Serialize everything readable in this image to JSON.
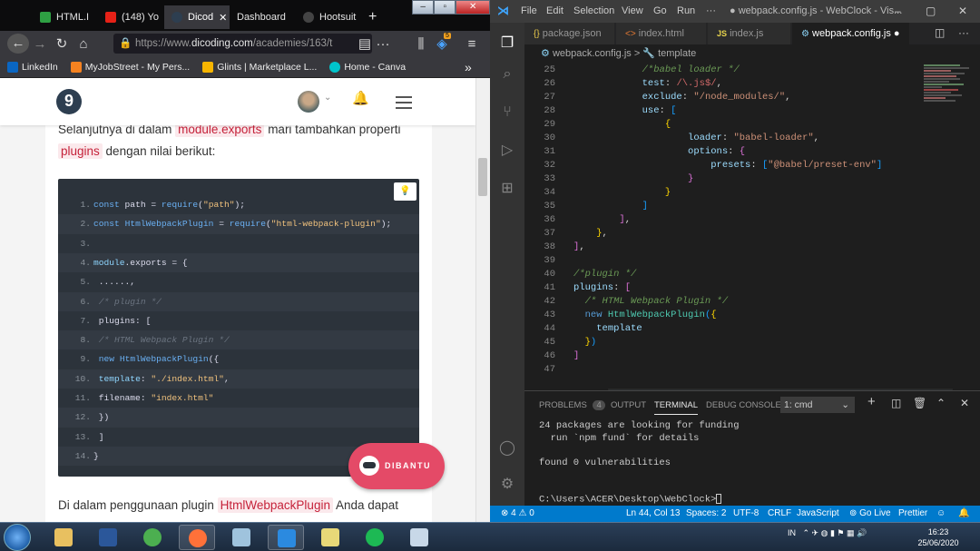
{
  "browser": {
    "tabs": [
      {
        "label": "HTML.I",
        "color": "#2ea043"
      },
      {
        "label": "(148) Yo",
        "color": "#e62117"
      },
      {
        "label": "Dicod",
        "color": "#2d3e50"
      },
      {
        "label": "Dashboard",
        "color": "#666"
      },
      {
        "label": "Hootsuit",
        "color": "#222"
      }
    ],
    "new_tab": "+",
    "url_prefix": "https://www.",
    "url_domain": "dicoding.com",
    "url_rest": "/academies/163/t",
    "ext_badge": "5",
    "bookmarks": [
      {
        "label": "LinkedIn",
        "color": "#0a66c2"
      },
      {
        "label": "MyJobStreet - My Pers...",
        "color": "#f58220"
      },
      {
        "label": "Glints | Marketplace L...",
        "color": "#f7b500"
      },
      {
        "label": "Home - Canva",
        "color": "#00c4cc"
      }
    ],
    "more": "»"
  },
  "site": {
    "logo": "9",
    "para1_a": "Selanjutnya di dalam",
    "para1_code": "module.exports",
    "para1_b": "mari tambahkan properti",
    "para2_code": "plugins",
    "para2_b": "dengan nilai berikut:",
    "copy_icon": "💡",
    "code_lines": [
      {
        "n": "1.",
        "html": "<span class='kw'>const</span> path = <span class='fn'>require</span>(<span class='st'>\"path\"</span>);"
      },
      {
        "n": "2.",
        "html": "<span class='kw'>const</span> <span class='fn'>HtmlWebpackPlugin</span> = <span class='fn'>require</span>(<span class='st'>\"html-webpack-plugin\"</span>);"
      },
      {
        "n": "3.",
        "html": ""
      },
      {
        "n": "4.",
        "html": "<span class='pr'>module</span>.exports = {"
      },
      {
        "n": "5.",
        "html": "   ......,"
      },
      {
        "n": "6.",
        "html": "    <span class='cm'>/* plugin */</span>"
      },
      {
        "n": "7.",
        "html": "    plugins: ["
      },
      {
        "n": "8.",
        "html": "        <span class='cm'>/* HTML Webpack Plugin */</span>"
      },
      {
        "n": "9.",
        "html": "        <span class='kw'>new</span> <span class='fn'>HtmlWebpackPlugin</span>({"
      },
      {
        "n": "10.",
        "html": "            <span class='pr'>template</span>: <span class='st'>\"./index.html\"</span>,"
      },
      {
        "n": "11.",
        "html": "            filename: <span class='st'>\"index.html\"</span>"
      },
      {
        "n": "12.",
        "html": "        })"
      },
      {
        "n": "13.",
        "html": "    ]"
      },
      {
        "n": "14.",
        "html": "}"
      }
    ],
    "para3_a": "Di dalam penggunaan plugin",
    "para3_code": "HtmlWebpackPlugin",
    "para3_b": "Anda dapat",
    "dibantu": "DIBANTU"
  },
  "vscode": {
    "menu": [
      "File",
      "Edit",
      "Selection",
      "View",
      "Go",
      "Run",
      "···"
    ],
    "title": "● webpack.config.js - WebClock - Vis...",
    "tabs": [
      "package.json",
      "index.html",
      "index.js",
      "webpack.config.js"
    ],
    "tab_prefix": [
      "{}",
      "<>",
      "JS",
      "⚙"
    ],
    "modified_dot": "●",
    "crumb_file": "webpack.config.js",
    "crumb_sep": ">",
    "crumb_symbol": "template",
    "lines": [
      {
        "n": "25",
        "html": "            <span class='c-cm'>/*babel loader */</span>"
      },
      {
        "n": "26",
        "html": "            <span class='c-key'>test</span><span class='c-w'>: </span><span class='c-rx'>/\\.js$/</span><span class='c-w'>,</span>"
      },
      {
        "n": "27",
        "html": "            <span class='c-key'>exclude</span><span class='c-w'>: </span><span class='c-str'>\"/node_modules/\"</span><span class='c-w'>,</span>"
      },
      {
        "n": "28",
        "html": "            <span class='c-key'>use</span><span class='c-w'>: </span><span class='c-br3'>[</span>"
      },
      {
        "n": "29",
        "html": "                <span class='c-br1'>{</span>"
      },
      {
        "n": "30",
        "html": "                    <span class='c-key'>loader</span><span class='c-w'>: </span><span class='c-str'>\"babel-loader\"</span><span class='c-w'>,</span>"
      },
      {
        "n": "31",
        "html": "                    <span class='c-key'>options</span><span class='c-w'>: </span><span class='c-br2'>{</span>"
      },
      {
        "n": "32",
        "html": "                        <span class='c-key'>presets</span><span class='c-w'>: </span><span class='c-br3'>[</span><span class='c-str'>\"@babel/preset-env\"</span><span class='c-br3'>]</span>"
      },
      {
        "n": "33",
        "html": "                    <span class='c-br2'>}</span>"
      },
      {
        "n": "34",
        "html": "                <span class='c-br1'>}</span>"
      },
      {
        "n": "35",
        "html": "            <span class='c-br3'>]</span>"
      },
      {
        "n": "36",
        "html": "        <span class='c-br2'>]</span><span class='c-w'>,</span>"
      },
      {
        "n": "37",
        "html": "    <span class='c-br1'>}</span><span class='c-w'>,</span>"
      },
      {
        "n": "38",
        "html": "<span class='c-br2'>]</span><span class='c-w'>,</span>"
      },
      {
        "n": "39",
        "html": ""
      },
      {
        "n": "40",
        "html": "<span class='c-cm'>/*plugin */</span>"
      },
      {
        "n": "41",
        "html": "<span class='c-key'>plugins</span><span class='c-w'>: </span><span class='c-br2'>[</span>"
      },
      {
        "n": "42",
        "html": "  <span class='c-cm'>/* HTML Webpack Plugin */</span>"
      },
      {
        "n": "43",
        "html": "  <span class='c-kw'>new</span> <span class='c-cls'>HtmlWebpackPlugin</span><span class='c-br3'>(</span><span class='c-br1'>{</span>"
      },
      {
        "n": "44",
        "html": "    <span class='c-key'>template</span>"
      },
      {
        "n": "45",
        "html": "  <span class='c-br1'>}</span><span class='c-br3'>)</span>"
      },
      {
        "n": "46",
        "html": "<span class='c-br2'>]</span>"
      },
      {
        "n": "47",
        "html": ""
      }
    ],
    "panel_tabs": [
      "PROBLEMS",
      "OUTPUT",
      "TERMINAL",
      "DEBUG CONSOLE"
    ],
    "problems_count": "4",
    "terminal_select": "1: cmd",
    "terminal_lines": [
      "24 packages are looking for funding",
      "  run `npm fund` for details",
      "",
      "found 0 vulnerabilities",
      "",
      "",
      "C:\\Users\\ACER\\Desktop\\WebClock>"
    ],
    "status": {
      "errors": "⊗ 4 ⚠ 0",
      "pos": "Ln 44, Col 13",
      "spaces": "Spaces: 2",
      "enc": "UTF-8",
      "eol": "CRLF",
      "lang": "JavaScript",
      "golive": "⊚ Go Live",
      "prettier": "Prettier"
    }
  },
  "taskbar": {
    "lang": "IN",
    "time": "16:23",
    "date": "25/06/2020",
    "apps": [
      {
        "name": "explorer",
        "color": "#e8c060"
      },
      {
        "name": "word",
        "color": "#2b579a"
      },
      {
        "name": "chrome",
        "color": "#4caf50"
      },
      {
        "name": "firefox",
        "color": "#ff7139"
      },
      {
        "name": "notes",
        "color": "#9fc3dd"
      },
      {
        "name": "vscode",
        "color": "#2b8ae0"
      },
      {
        "name": "sticky",
        "color": "#e8d878"
      },
      {
        "name": "spotify",
        "color": "#1db954"
      },
      {
        "name": "paint",
        "color": "#c8d8e8"
      }
    ]
  }
}
